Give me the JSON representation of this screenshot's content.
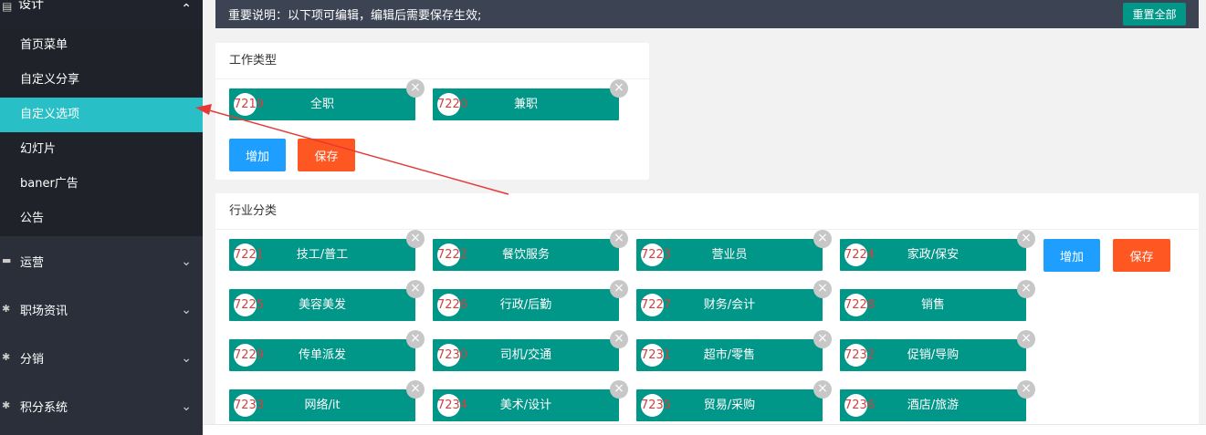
{
  "sidebar": {
    "header": {
      "label": "设计",
      "icon": "layout-icon",
      "chevron": "⌃"
    },
    "sub_items": [
      {
        "label": "首页菜单"
      },
      {
        "label": "自定义分享"
      },
      {
        "label": "自定义选项"
      },
      {
        "label": "幻灯片"
      },
      {
        "label": "baner广告"
      },
      {
        "label": "公告"
      }
    ],
    "groups": [
      {
        "label": "运营"
      },
      {
        "label": "职场资讯"
      },
      {
        "label": "分销"
      },
      {
        "label": "积分系统"
      }
    ]
  },
  "notice": {
    "text": "重要说明：以下项可编辑，编辑后需要保存生效;",
    "reset_label": "重置全部"
  },
  "work_type": {
    "title": "工作类型",
    "tags": [
      {
        "id": "7219",
        "label": "全职"
      },
      {
        "id": "7220",
        "label": "兼职"
      }
    ],
    "add_label": "增加",
    "save_label": "保存"
  },
  "industry": {
    "title": "行业分类",
    "tags": [
      {
        "id": "7221",
        "label": "技工/普工"
      },
      {
        "id": "7222",
        "label": "餐饮服务"
      },
      {
        "id": "7223",
        "label": "营业员"
      },
      {
        "id": "7224",
        "label": "家政/保安"
      },
      {
        "id": "7225",
        "label": "美容美发"
      },
      {
        "id": "7226",
        "label": "行政/后勤"
      },
      {
        "id": "7227",
        "label": "财务/会计"
      },
      {
        "id": "7228",
        "label": "销售"
      },
      {
        "id": "7229",
        "label": "传单派发"
      },
      {
        "id": "7230",
        "label": "司机/交通"
      },
      {
        "id": "7231",
        "label": "超市/零售"
      },
      {
        "id": "7232",
        "label": "促销/导购"
      },
      {
        "id": "7233",
        "label": "网络/it"
      },
      {
        "id": "7234",
        "label": "美术/设计"
      },
      {
        "id": "7235",
        "label": "贸易/采购"
      },
      {
        "id": "7236",
        "label": "酒店/旅游"
      }
    ],
    "add_label": "增加",
    "save_label": "保存"
  },
  "close_glyph": "×",
  "colors": {
    "tag": "#009688",
    "add": "#1e9fff",
    "save": "#ff5722",
    "active": "#28c0c6",
    "arrow": "#e53935"
  }
}
